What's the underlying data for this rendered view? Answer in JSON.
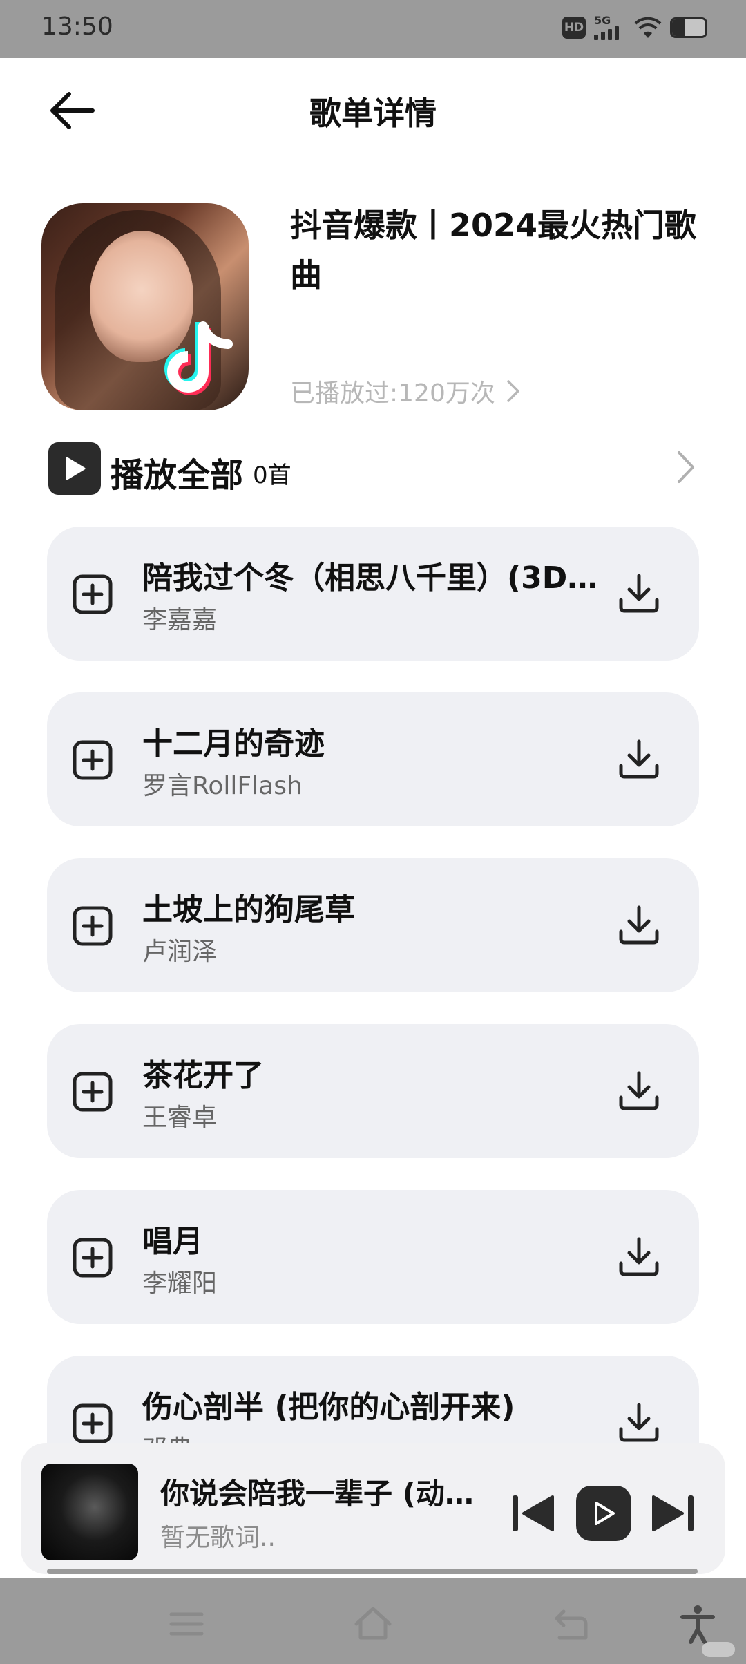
{
  "status_bar": {
    "time": "13:50",
    "hd": "HD",
    "network": "5G"
  },
  "header": {
    "title": "歌单详情"
  },
  "playlist": {
    "title": "抖音爆款丨2024最火热门歌曲",
    "play_count": "已播放过:120万次"
  },
  "play_all": {
    "label": "播放全部",
    "count": "0首"
  },
  "songs": [
    {
      "title": "陪我过个冬（相思八千里）(3D...",
      "artist": "李嘉嘉"
    },
    {
      "title": "十二月的奇迹",
      "artist": "罗言RollFlash"
    },
    {
      "title": "土坡上的狗尾草",
      "artist": "卢润泽"
    },
    {
      "title": "茶花开了",
      "artist": "王睿卓"
    },
    {
      "title": "唱月",
      "artist": "李耀阳"
    },
    {
      "title": "伤心剖半 (把你的心剖开来)",
      "artist": "邓典"
    }
  ],
  "mini_player": {
    "title": "你说会陪我一辈子 (动感...",
    "lyric": "暂无歌词..",
    "progress": 0
  },
  "colors": {
    "status_bar_bg": "#9b9b9b",
    "card_bg": "#eff0f4",
    "dark": "#2b2b2b",
    "muted": "#b7b7b7"
  }
}
